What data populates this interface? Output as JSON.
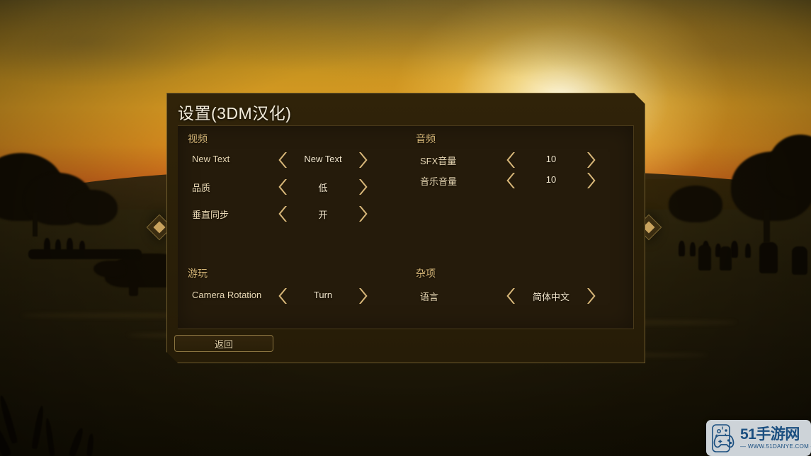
{
  "dialog": {
    "title": "设置(3DM汉化)",
    "back_label": "返回"
  },
  "groups": {
    "video": {
      "header": "视频",
      "rows": [
        {
          "label": "New Text",
          "value": "New Text",
          "left_icon": "chevron-left-icon",
          "right_icon": "chevron-right-icon"
        },
        {
          "label": "品质",
          "value": "低",
          "left_icon": "chevron-left-icon",
          "right_icon": "chevron-right-icon"
        },
        {
          "label": "垂直同步",
          "value": "开",
          "left_icon": "chevron-left-icon",
          "right_icon": "chevron-right-icon"
        }
      ]
    },
    "audio": {
      "header": "音频",
      "rows": [
        {
          "label": "SFX音量",
          "value": "10",
          "left_icon": "chevron-left-icon",
          "right_icon": "chevron-right-icon"
        },
        {
          "label": "音乐音量",
          "value": "10",
          "left_icon": "chevron-left-icon",
          "right_icon": "chevron-right-icon"
        }
      ]
    },
    "gameplay": {
      "header": "游玩",
      "rows": [
        {
          "label": "Camera Rotation",
          "value": "Turn",
          "left_icon": "chevron-left-icon",
          "right_icon": "chevron-right-icon"
        }
      ]
    },
    "misc": {
      "header": "杂项",
      "rows": [
        {
          "label": "语言",
          "value": "简体中文",
          "left_icon": "chevron-left-icon",
          "right_icon": "chevron-right-icon"
        }
      ]
    }
  },
  "decorations": {
    "left_diamond": "diamond-marker-icon",
    "right_diamond": "diamond-marker-icon"
  },
  "watermark": {
    "brand": "51手游网",
    "url": "— WWW.51DANYE.COM —",
    "icon": "gamepad-phone-icon"
  },
  "colors": {
    "accent_gold": "#c9a35e",
    "panel_bg": "#251b0b",
    "dialog_bg": "#2b2008",
    "border_gold": "#6d5a2c",
    "text_light": "#f2e6cc",
    "header_gold": "#d8b878",
    "watermark_blue": "#1b4f80"
  }
}
